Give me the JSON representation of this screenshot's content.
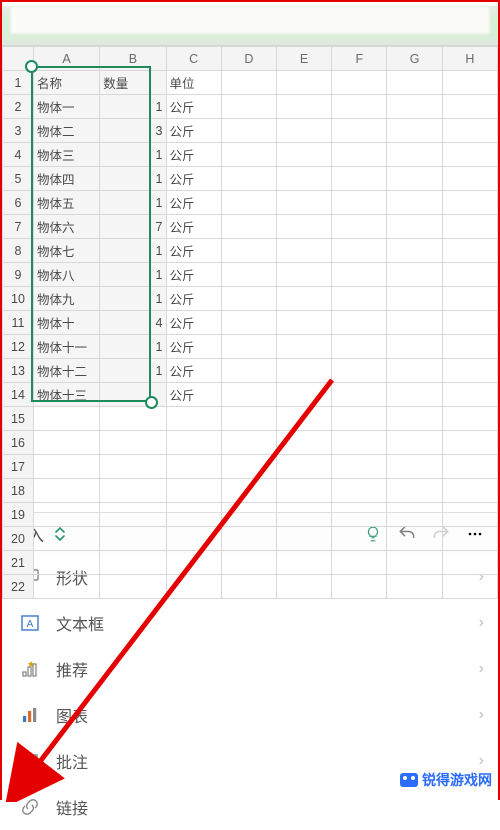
{
  "columns": [
    "A",
    "B",
    "C",
    "D",
    "E",
    "F",
    "G",
    "H"
  ],
  "header_row": {
    "a": "名称",
    "b": "数量",
    "c": "单位"
  },
  "rows": [
    {
      "n": 1
    },
    {
      "n": 2,
      "a": "物体一",
      "b": 1,
      "c": "公斤"
    },
    {
      "n": 3,
      "a": "物体二",
      "b": 3,
      "c": "公斤"
    },
    {
      "n": 4,
      "a": "物体三",
      "b": 1,
      "c": "公斤"
    },
    {
      "n": 5,
      "a": "物体四",
      "b": 1,
      "c": "公斤"
    },
    {
      "n": 6,
      "a": "物体五",
      "b": 1,
      "c": "公斤"
    },
    {
      "n": 7,
      "a": "物体六",
      "b": 7,
      "c": "公斤"
    },
    {
      "n": 8,
      "a": "物体七",
      "b": 1,
      "c": "公斤"
    },
    {
      "n": 9,
      "a": "物体八",
      "b": 1,
      "c": "公斤"
    },
    {
      "n": 10,
      "a": "物体九",
      "b": 1,
      "c": "公斤"
    },
    {
      "n": 11,
      "a": "物体十",
      "b": 4,
      "c": "公斤"
    },
    {
      "n": 12,
      "a": "物体十一",
      "b": 1,
      "c": "公斤"
    },
    {
      "n": 13,
      "a": "物体十二",
      "b": 1,
      "c": "公斤"
    },
    {
      "n": 14,
      "a": "物体十三",
      "b": "",
      "c": "公斤"
    }
  ],
  "extra_row_numbers": [
    15,
    16,
    17,
    18,
    19,
    20,
    21,
    22
  ],
  "toolbar": {
    "tab_label": "插入"
  },
  "menu": {
    "items": [
      {
        "key": "shape",
        "label": "形状"
      },
      {
        "key": "textbox",
        "label": "文本框"
      },
      {
        "key": "recommend",
        "label": "推荐"
      },
      {
        "key": "chart",
        "label": "图表"
      },
      {
        "key": "comment",
        "label": "批注"
      },
      {
        "key": "link",
        "label": "链接"
      }
    ]
  },
  "watermark": "锐得游戏网",
  "colors": {
    "accent": "#1f8a5a",
    "annotation": "#e40000"
  }
}
